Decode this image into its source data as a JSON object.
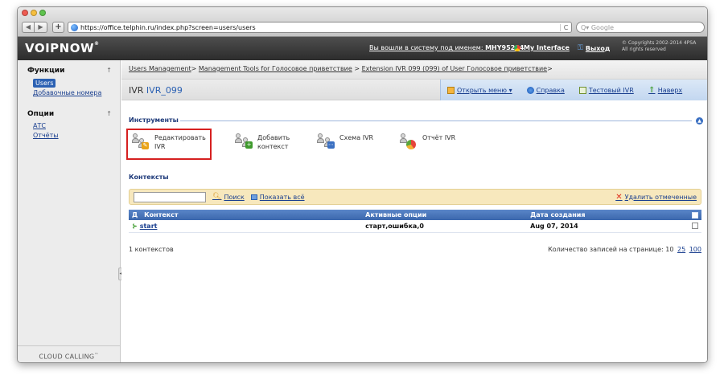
{
  "browser": {
    "url": "https://office.telphin.ru/index.php?screen=users/users",
    "search_placeholder": "Q▾ Google",
    "reload": "C",
    "back": "◀",
    "forward": "▶",
    "add": "+"
  },
  "header": {
    "logo": "VOIPNOW",
    "logo_tm": "®",
    "user_prefix": "Вы вошли в систему под именем: ",
    "user_name": "MHY95234",
    "my_interface": "My Interface",
    "logout": "Выход",
    "copyright_line1": "© Copyrights 2002-2014 4PSA",
    "copyright_line2": "All rights reserved"
  },
  "sidebar": {
    "sections": [
      {
        "title": "Функции",
        "arrow": "↑",
        "items": [
          {
            "label": "Users",
            "active": true
          },
          {
            "label": "Добавочные номера",
            "active": false
          }
        ]
      },
      {
        "title": "Опции",
        "arrow": "↑",
        "items": [
          {
            "label": "АТС",
            "active": false
          },
          {
            "label": "Отчёты",
            "active": false
          }
        ]
      }
    ],
    "bottom": "CLOUD CALLING",
    "bottom_tm": "™"
  },
  "breadcrumb": {
    "items": [
      "Users Management",
      "Management Tools for Голосовое приветствие",
      "Extension IVR 099 (099) of User Голосовое приветствие"
    ],
    "sep": ">"
  },
  "page": {
    "title_prefix": "IVR ",
    "title_ext": "IVR_099"
  },
  "toolbar": {
    "open_menu": "Открыть меню ▾",
    "help": "Справка",
    "test_ivr": "Тестовый IVR",
    "up": "Наверх"
  },
  "tools": {
    "heading": "Инструменты",
    "items": [
      {
        "line1": "Редактировать",
        "line2": "IVR"
      },
      {
        "line1": "Добавить",
        "line2": "контекст"
      },
      {
        "line1": "Схема IVR",
        "line2": ""
      },
      {
        "line1": "Отчёт IVR",
        "line2": ""
      }
    ]
  },
  "contexts": {
    "heading": "Контексты",
    "search": "Поиск",
    "show_all": "Показать всё",
    "delete_selected": "Удалить отмеченные",
    "columns": [
      "Д",
      "Контекст",
      "Активные опции",
      "Дата создания"
    ],
    "rows": [
      {
        "name": "start",
        "options": "старт,ошибка,0",
        "date": "Aug 07, 2014"
      }
    ],
    "summary": "1 контекстов",
    "per_page_label": "Количество записей на странице: 10",
    "per_page_25": "25",
    "per_page_100": "100"
  },
  "colors": {
    "accent": "#2b61b3",
    "highlight": "#d62020",
    "filter_bg": "#f7e8bd"
  }
}
